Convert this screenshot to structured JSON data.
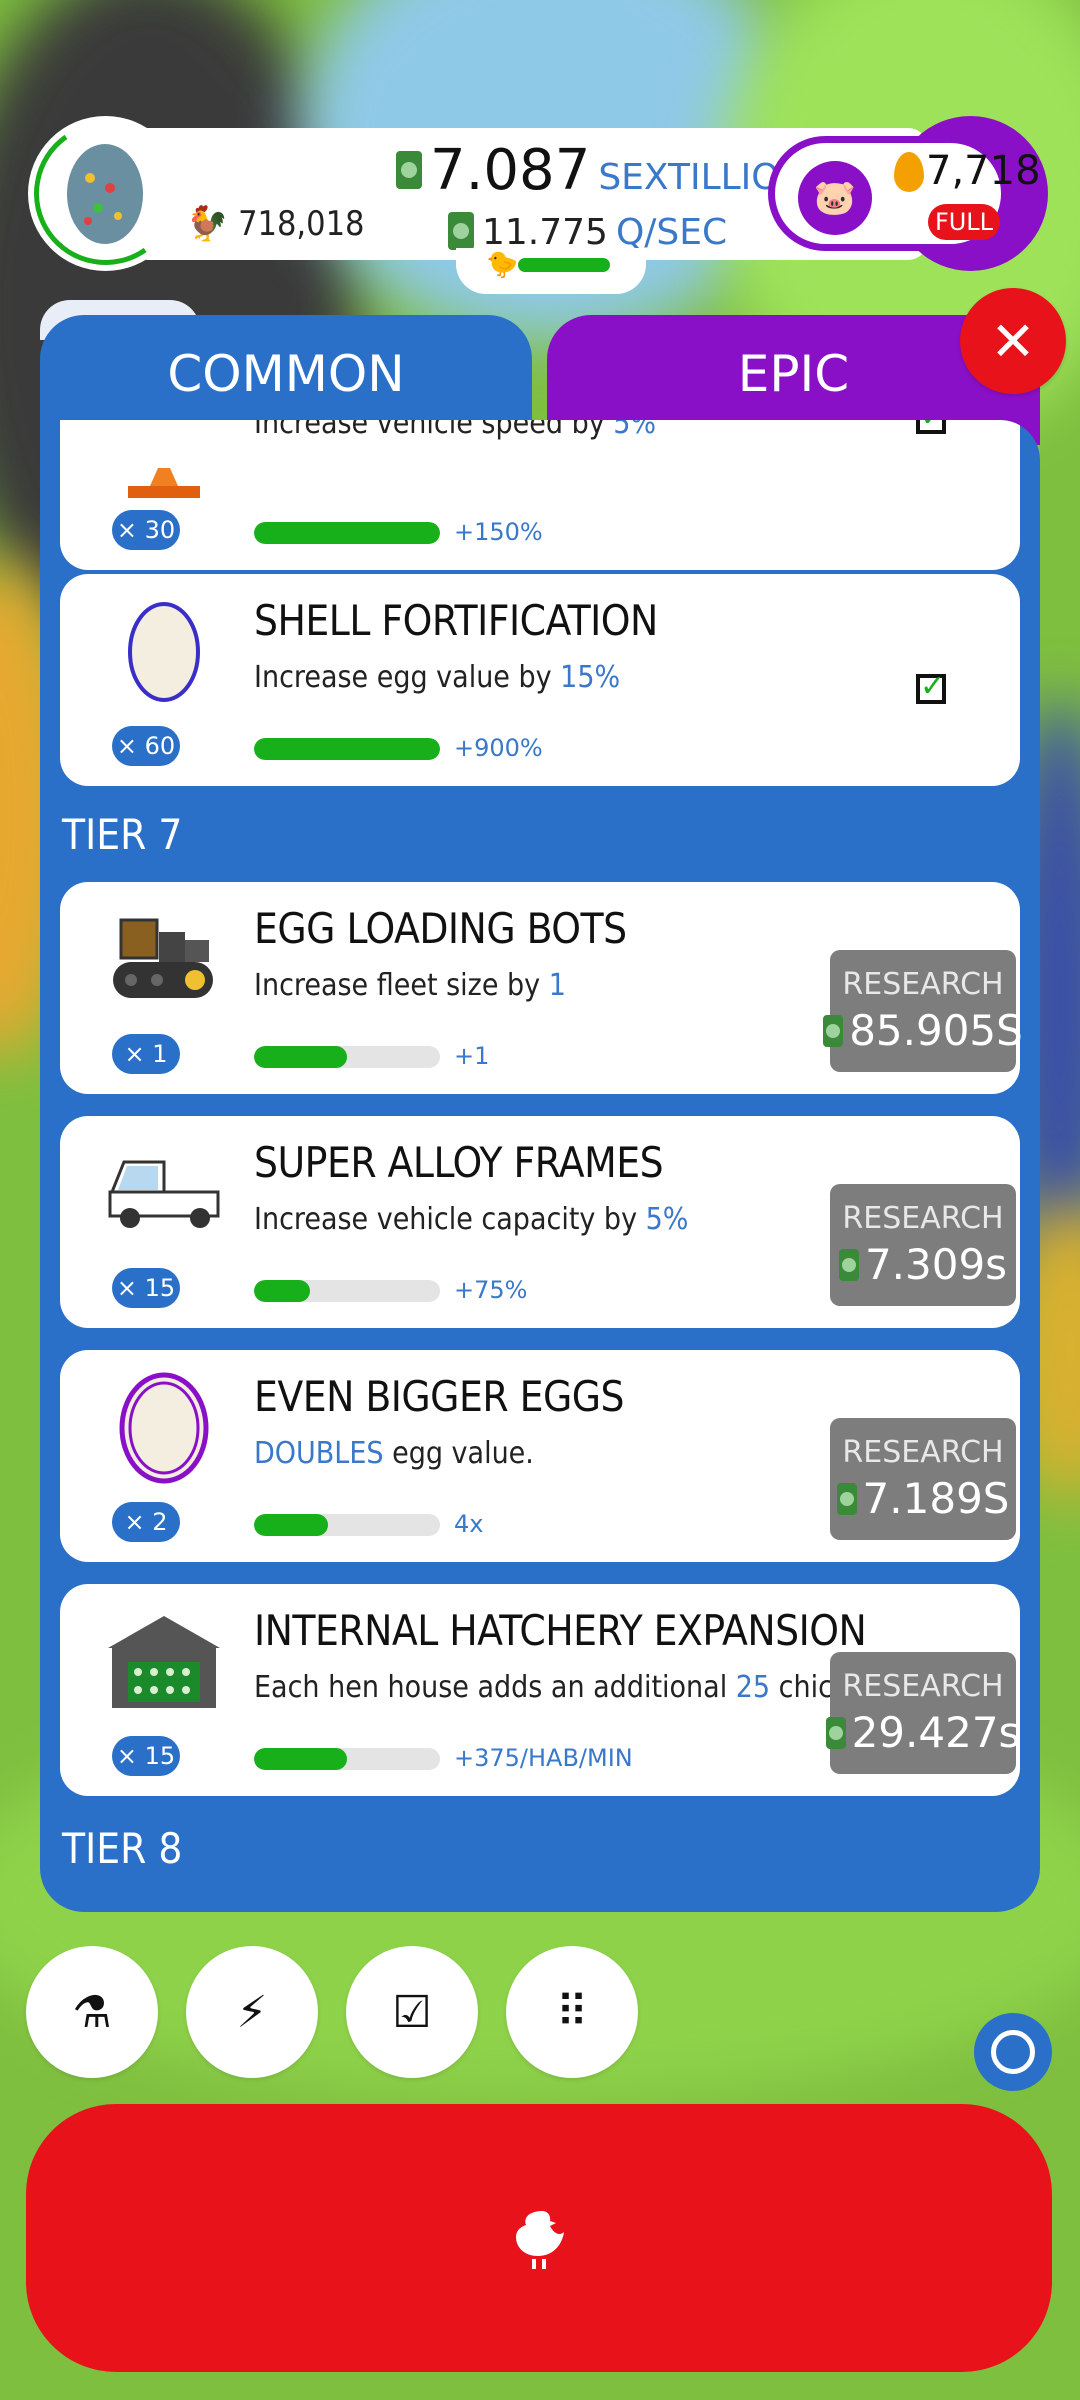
{
  "header": {
    "population": "718,018",
    "money_value": "7.087",
    "money_unit": "SEXTILLION",
    "rate_value": "11.775",
    "rate_unit": "Q/SEC",
    "golden_eggs": "7,718",
    "bank_status": "FULL"
  },
  "tabs": [
    {
      "label": "COMMON"
    },
    {
      "label": "EPIC"
    }
  ],
  "close_glyph": "✕",
  "cards": [
    {
      "icon": "orange-cone-icon",
      "title": "",
      "desc_pre": "Increase vehicle speed by ",
      "desc_hl": "5%",
      "desc_post": "",
      "mult": "× 30",
      "progress": 1.0,
      "gain": "+150%",
      "completed": true
    },
    {
      "icon": "egg-icon",
      "title": "SHELL FORTIFICATION",
      "desc_pre": "Increase egg value by ",
      "desc_hl": "15%",
      "desc_post": "",
      "mult": "× 60",
      "progress": 1.0,
      "gain": "+900%",
      "completed": true
    },
    {
      "icon": "loading-bot-icon",
      "title": "EGG LOADING BOTS",
      "desc_pre": "Increase fleet size by ",
      "desc_hl": "1",
      "desc_post": "",
      "mult": "× 1",
      "progress": 0.5,
      "gain": "+1",
      "research_label": "RESEARCH",
      "price": "85.905S"
    },
    {
      "icon": "truck-icon",
      "title": "SUPER ALLOY FRAMES",
      "desc_pre": "Increase vehicle capacity by ",
      "desc_hl": "5%",
      "desc_post": "",
      "mult": "× 15",
      "progress": 0.3,
      "gain": "+75%",
      "research_label": "RESEARCH",
      "price": "7.309s"
    },
    {
      "icon": "purple-egg-icon",
      "title": "EVEN BIGGER EGGS",
      "desc_pre": "",
      "desc_hl": "DOUBLES",
      "desc_post": " egg value.",
      "mult": "× 2",
      "progress": 0.4,
      "gain": "4x",
      "research_label": "RESEARCH",
      "price": "7.189S"
    },
    {
      "icon": "hen-house-icon",
      "title": "INTERNAL HATCHERY EXPANSION",
      "desc_pre": "Each hen house adds an additional ",
      "desc_hl": "25",
      "desc_post": " chickens/min",
      "mult": "× 15",
      "progress": 0.5,
      "gain": "+375/HAB/MIN",
      "research_label": "RESEARCH",
      "price": "29.427s"
    }
  ],
  "tiers": [
    "TIER 7",
    "TIER 8"
  ],
  "bottom_buttons": [
    {
      "icon": "flask-icon",
      "glyph": "⚗"
    },
    {
      "icon": "lightning-icon",
      "glyph": "⚡"
    },
    {
      "icon": "checklist-icon",
      "glyph": "☑"
    },
    {
      "icon": "grid-icon",
      "glyph": "⠿"
    }
  ],
  "main_button_icon": "chicken-icon",
  "colors": {
    "panel_blue": "#2b70c8",
    "epic_purple": "#8a10c8",
    "accent_red": "#e8121b",
    "progress_green": "#18b01a"
  }
}
